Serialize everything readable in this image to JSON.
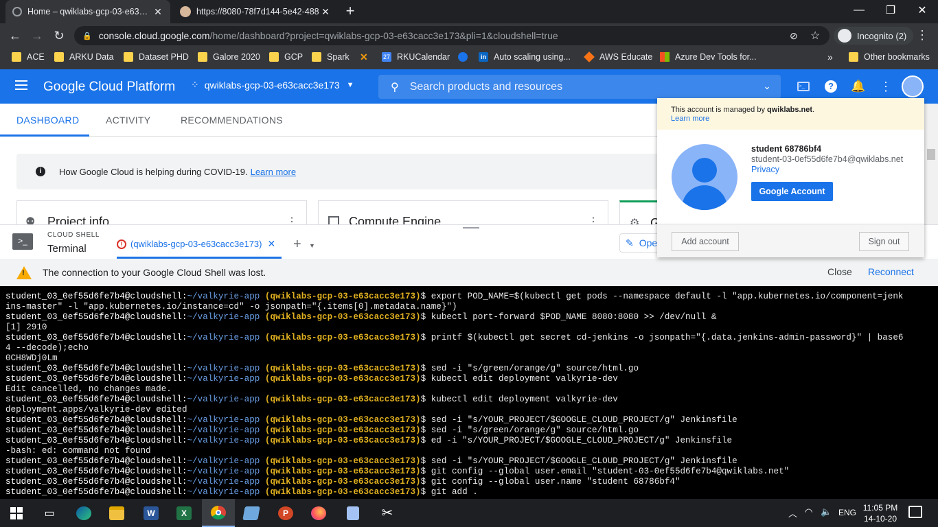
{
  "browser": {
    "tabs": [
      {
        "title": "Home – qwiklabs-gcp-03-e63…",
        "active": true
      },
      {
        "title": "https://8080-78f7d144-5e42-488",
        "active": false
      }
    ],
    "url_host": "console.cloud.google.com",
    "url_path": "/home/dashboard?project=qwiklabs-gcp-03-e63cacc3e173&pli=1&cloudshell=true",
    "incognito_label": "Incognito (2)",
    "bookmarks": [
      "ACE",
      "ARKU Data",
      "Dataset PHD",
      "Galore 2020",
      "GCP",
      "Spark",
      "RKUCalendar",
      "Auto scaling using...",
      "AWS Educate",
      "Azure Dev Tools for...",
      "Other bookmarks"
    ],
    "bookmarks_overflow": "»"
  },
  "gcp": {
    "logo": "Google Cloud Platform",
    "project": "qwiklabs-gcp-03-e63cacc3e173",
    "search_placeholder": "Search products and resources",
    "tabs": [
      "DASHBOARD",
      "ACTIVITY",
      "RECOMMENDATIONS"
    ],
    "covid_text": "How Google Cloud is helping during COVID-19.",
    "covid_link": "Learn more",
    "cards": [
      "Project info",
      "Compute Engine",
      "G"
    ],
    "accent": "#1a73e8"
  },
  "account": {
    "managed_text": "This account is managed by",
    "managed_domain": "qwiklabs.net",
    "managed_suffix": ".",
    "learn_more": "Learn more",
    "name": "student 68786bf4",
    "email": "student-03-0ef55d6fe7b4@qwiklabs.net",
    "privacy": "Privacy",
    "google_account": "Google Account",
    "add_account": "Add account",
    "sign_out": "Sign out"
  },
  "shell": {
    "label": "CLOUD SHELL",
    "terminal": "Terminal",
    "tab": "(qwiklabs-gcp-03-e63cacc3e173)",
    "open_editor": "Ope",
    "lost_msg": "The connection to your Google Cloud Shell was lost.",
    "close": "Close",
    "reconnect": "Reconnect",
    "user": "student_03_0ef55d6fe7b4@cloudshell:",
    "path": "~/valkyrie-app",
    "proj": "(qwiklabs-gcp-03-e63cacc3e173)",
    "lines": [
      {
        "t": "p",
        "cmd": "$ export POD_NAME=$(kubectl get pods --namespace default -l \"app.kubernetes.io/component=jenk"
      },
      {
        "t": "o",
        "text": "ins-master\" -l \"app.kubernetes.io/instance=cd\" -o jsonpath=\"{.items[0].metadata.name}\")"
      },
      {
        "t": "p",
        "cmd": "$ kubectl port-forward $POD_NAME 8080:8080 >> /dev/null &"
      },
      {
        "t": "o",
        "text": "[1] 2910"
      },
      {
        "t": "p",
        "cmd": "$ printf $(kubectl get secret cd-jenkins -o jsonpath=\"{.data.jenkins-admin-password}\" | base6"
      },
      {
        "t": "o",
        "text": "4 --decode);echo"
      },
      {
        "t": "o",
        "text": "0CH8WDj0Lm"
      },
      {
        "t": "p",
        "cmd": "$ sed -i \"s/green/orange/g\" source/html.go"
      },
      {
        "t": "p",
        "cmd": "$ kubectl edit deployment valkyrie-dev"
      },
      {
        "t": "o",
        "text": "Edit cancelled, no changes made."
      },
      {
        "t": "p",
        "cmd": "$ kubectl edit deployment valkyrie-dev"
      },
      {
        "t": "o",
        "text": "deployment.apps/valkyrie-dev edited"
      },
      {
        "t": "p",
        "cmd": "$ sed -i \"s/YOUR_PROJECT/$GOOGLE_CLOUD_PROJECT/g\" Jenkinsfile"
      },
      {
        "t": "p",
        "cmd": "$ sed -i \"s/green/orange/g\" source/html.go"
      },
      {
        "t": "p",
        "cmd": "$ ed -i \"s/YOUR_PROJECT/$GOOGLE_CLOUD_PROJECT/g\" Jenkinsfile"
      },
      {
        "t": "o",
        "text": "-bash: ed: command not found"
      },
      {
        "t": "p",
        "cmd": "$ sed -i \"s/YOUR_PROJECT/$GOOGLE_CLOUD_PROJECT/g\" Jenkinsfile"
      },
      {
        "t": "p",
        "cmd": "$ git config --global user.email \"student-03-0ef55d6fe7b4@qwiklabs.net\""
      },
      {
        "t": "p",
        "cmd": "$ git config --global user.name \"student 68786bf4\""
      },
      {
        "t": "p",
        "cmd": "$ git add ."
      }
    ]
  },
  "taskbar": {
    "lang": "ENG",
    "time": "11:05 PM",
    "date": "14-10-20"
  }
}
